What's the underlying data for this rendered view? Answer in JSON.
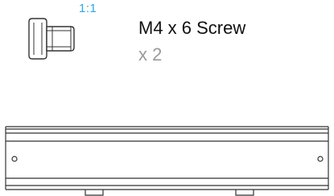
{
  "part": {
    "scale_label": "1:1",
    "name": "M4 x 6 Screw",
    "quantity": "x 2"
  },
  "icons": {
    "screw": "screw-icon",
    "rail": "din-rail-icon"
  },
  "colors": {
    "scale": "#29a9e0",
    "name": "#111111",
    "quantity": "#9a9a9a",
    "line_art": "#333333"
  }
}
